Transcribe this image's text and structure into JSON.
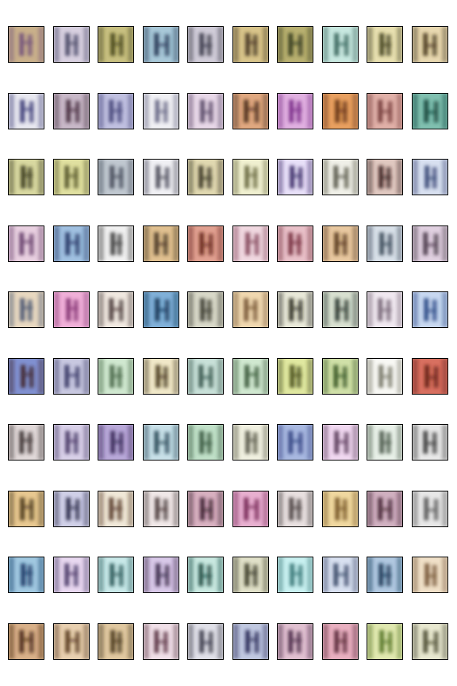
{
  "figure": {
    "rows": 10,
    "cols": 10,
    "background": "#ffffff",
    "tile_border_color": "#000000",
    "tiles": [
      [
        "#c9b08a",
        "#6a4a7a"
      ],
      [
        "#d8d0e0",
        "#3a3a5a"
      ],
      [
        "#c8c080",
        "#3a3a10"
      ],
      [
        "#a8c8d8",
        "#1a2a4a"
      ],
      [
        "#d0ccd8",
        "#2a2a3a"
      ],
      [
        "#d8c48a",
        "#3a2a1a"
      ],
      [
        "#b8b070",
        "#2a3018"
      ],
      [
        "#c8e8e0",
        "#2a5850"
      ],
      [
        "#e8e0b0",
        "#303010"
      ],
      [
        "#e8d8b0",
        "#3a2a10"
      ],
      [
        "#e8e8f0",
        "#2a2a6a"
      ],
      [
        "#c8b8c8",
        "#3a2030"
      ],
      [
        "#c0c0e0",
        "#3a3a70"
      ],
      [
        "#f0f0f4",
        "#5a5a7a"
      ],
      [
        "#e8d8e8",
        "#4a3a5a"
      ],
      [
        "#e0a880",
        "#3a2010"
      ],
      [
        "#e0b0e0",
        "#702080"
      ],
      [
        "#e8a060",
        "#5a2a10"
      ],
      [
        "#e0b0a8",
        "#6a3030"
      ],
      [
        "#80c0b0",
        "#0a3a30"
      ],
      [
        "#d8d8a0",
        "#2a2a10"
      ],
      [
        "#e0e0a0",
        "#4a4a20"
      ],
      [
        "#c0c8d0",
        "#3a4050"
      ],
      [
        "#f0f0f4",
        "#3a3a4a"
      ],
      [
        "#e0d8b0",
        "#2a2818"
      ],
      [
        "#f0f0d0",
        "#5a5a30"
      ],
      [
        "#e8e0f8",
        "#2a1a5a"
      ],
      [
        "#f0f0e8",
        "#4a4a3a"
      ],
      [
        "#e0c8c0",
        "#2a1010"
      ],
      [
        "#d8e0f0",
        "#2a3a6a"
      ],
      [
        "#e8d0e0",
        "#5a3060"
      ],
      [
        "#a0c0e0",
        "#1a2a5a"
      ],
      [
        "#f0f0f0",
        "#2a2a2a"
      ],
      [
        "#e0c090",
        "#3a2a1a"
      ],
      [
        "#e0a090",
        "#5a1a10"
      ],
      [
        "#f0d8e0",
        "#7a3a50"
      ],
      [
        "#e8c0c8",
        "#6a2030"
      ],
      [
        "#e8c8a0",
        "#4a2a10"
      ],
      [
        "#d8e0e8",
        "#2a3a4a"
      ],
      [
        "#e0d0e0",
        "#3a2a3a"
      ],
      [
        "#e8d8c0",
        "#3a4a6a"
      ],
      [
        "#f0b0d8",
        "#7a2a6a"
      ],
      [
        "#f0e8e0",
        "#3a2a2a"
      ],
      [
        "#80b0d8",
        "#0a2a4a"
      ],
      [
        "#d8d8c8",
        "#2a2a20"
      ],
      [
        "#f0d8b0",
        "#6a4a2a"
      ],
      [
        "#e8e8d8",
        "#1a1a10"
      ],
      [
        "#d8e0d0",
        "#1a2820"
      ],
      [
        "#f0e8f0",
        "#6a5a6a"
      ],
      [
        "#c8d8f0",
        "#1a3a7a"
      ],
      [
        "#8090d0",
        "#3a1a1a"
      ],
      [
        "#c8c8e0",
        "#2a2a5a"
      ],
      [
        "#d0e8d0",
        "#3a5a3a"
      ],
      [
        "#f0e8c8",
        "#3a2a10"
      ],
      [
        "#c8e0d8",
        "#2a4a40"
      ],
      [
        "#d0e8d0",
        "#2a4a2a"
      ],
      [
        "#e0e8a0",
        "#3a4010"
      ],
      [
        "#d0e0a8",
        "#2a4a18"
      ],
      [
        "#f8f8f4",
        "#6a6a5a"
      ],
      [
        "#d87060",
        "#5a1a10"
      ],
      [
        "#e0d8d8",
        "#2a2020"
      ],
      [
        "#d8d0e8",
        "#3a2a5a"
      ],
      [
        "#b8a8d8",
        "#2a1a4a"
      ],
      [
        "#c8e0e8",
        "#1a3a4a"
      ],
      [
        "#c0e0c8",
        "#2a4a30"
      ],
      [
        "#f0f0e0",
        "#4a4a3a"
      ],
      [
        "#a8b8e0",
        "#2a3a7a"
      ],
      [
        "#f0d8f0",
        "#4a2a4a"
      ],
      [
        "#e8f0e8",
        "#3a4a3a"
      ],
      [
        "#e8e8e8",
        "#2a2a2a"
      ],
      [
        "#e8c890",
        "#3a2a10"
      ],
      [
        "#d0d0e8",
        "#1a1a3a"
      ],
      [
        "#f0e8d8",
        "#4a2a1a"
      ],
      [
        "#f0e8e8",
        "#3a2a2a"
      ],
      [
        "#d8b0c0",
        "#2a1020"
      ],
      [
        "#e8b0d0",
        "#6a1a4a"
      ],
      [
        "#e8e0e0",
        "#3a3030"
      ],
      [
        "#f0d8a0",
        "#6a4a1a"
      ],
      [
        "#d0b0c0",
        "#3a1a2a"
      ],
      [
        "#e8e8e8",
        "#4a4a4a"
      ],
      [
        "#a0c8e0",
        "#0a2a5a"
      ],
      [
        "#e8d8f0",
        "#3a2a5a"
      ],
      [
        "#c8e8e8",
        "#1a4a4a"
      ],
      [
        "#d8c8e8",
        "#2a1a3a"
      ],
      [
        "#c8e8e0",
        "#0a3a30"
      ],
      [
        "#e0e0c8",
        "#2a2a18"
      ],
      [
        "#c8f0f0",
        "#2a6a6a"
      ],
      [
        "#d8e0f0",
        "#2a3a5a"
      ],
      [
        "#b0c8e0",
        "#0a2a4a"
      ],
      [
        "#f0e0c8",
        "#6a4a2a"
      ],
      [
        "#d8b088",
        "#3a1a0a"
      ],
      [
        "#e8d0b0",
        "#4a2a10"
      ],
      [
        "#e0c8a0",
        "#3a2a10"
      ],
      [
        "#f0e0e8",
        "#4a2030"
      ],
      [
        "#e0e0e8",
        "#2a2a3a"
      ],
      [
        "#c0c8e0",
        "#1a1a4a"
      ],
      [
        "#e0c0d0",
        "#3a1a3a"
      ],
      [
        "#e8b0c0",
        "#4a1a2a"
      ],
      [
        "#e0e8b0",
        "#4a6a1a"
      ],
      [
        "#e8e8d0",
        "#3a3a20"
      ]
    ]
  }
}
